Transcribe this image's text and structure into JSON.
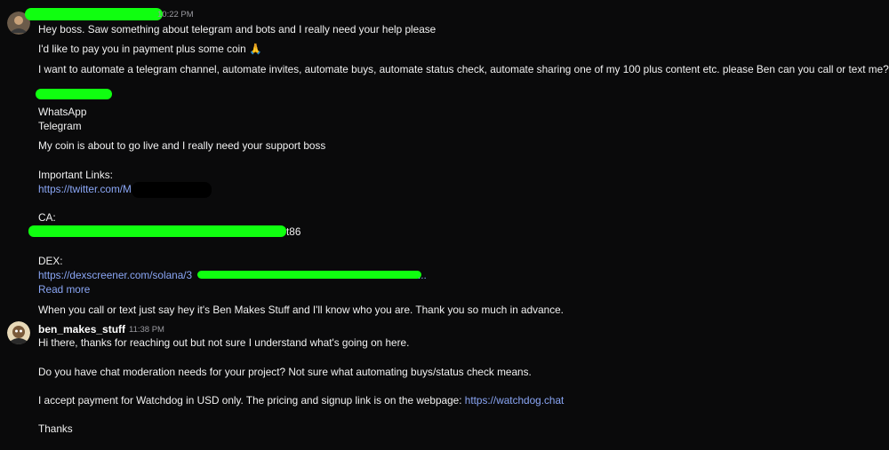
{
  "messages": [
    {
      "time": "10:22 PM",
      "lines": {
        "l1": "Hey boss. Saw something about telegram and bots and I really need your help please",
        "l2": "I'd like to pay you in payment plus some coin 🙏",
        "l3": "I want to automate a telegram channel, automate invites, automate buys, automate status check, automate sharing one of my 100 plus content etc. please Ben can you call or text me?",
        "l4": "WhatsApp",
        "l5": "Telegram",
        "l6": "My coin is about to go live and I really need your support boss",
        "l7": "Important Links:",
        "l8": "https://twitter.com/M",
        "l9": "CA:",
        "l10": "t86",
        "l11": "DEX:",
        "l12": "https://dexscreener.com/solana/3",
        "l12end": "...",
        "read_more": "Read more",
        "l13": "When you call or text just say hey it's Ben Makes Stuff and I'll know who you are. Thank you so much in advance."
      }
    },
    {
      "username": "ben_makes_stuff",
      "time": "11:38 PM",
      "lines": {
        "r1": "Hi there, thanks for reaching out but not sure I understand what's going on here.",
        "r2": "Do you have chat moderation needs for your project? Not sure what automating buys/status check means.",
        "r3": "I accept payment for Watchdog in USD only. The pricing and signup link is on the webpage: ",
        "r3_link": "https://watchdog.chat",
        "r4": "Thanks"
      }
    }
  ],
  "colors": {
    "background": "#0a0a0b",
    "text": "#f2f2f2",
    "link": "#8aa6f5",
    "timestamp": "#9a9aa0",
    "redaction": "#10ff10"
  }
}
